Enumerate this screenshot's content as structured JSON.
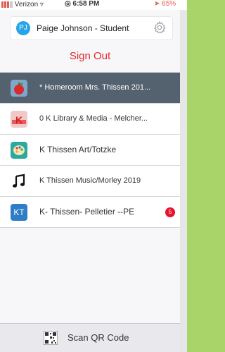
{
  "status_bar": {
    "carrier": "Verizon",
    "time": "6:58 PM",
    "battery": "65%"
  },
  "user": {
    "initials": "PJ",
    "name": "Paige Johnson - Student"
  },
  "sign_out_label": "Sign Out",
  "classes": [
    {
      "label": "* Homeroom Mrs. Thissen 201...",
      "icon": "apple-icon",
      "selected": true
    },
    {
      "label": "0 K Library & Media - Melcher...",
      "icon": "k-library-icon",
      "selected": false
    },
    {
      "label": "K Thissen Art/Totzke",
      "icon": "palette-icon",
      "selected": false
    },
    {
      "label": "K Thissen Music/Morley 2019",
      "icon": "music-note-icon",
      "selected": false
    },
    {
      "label": "K- Thissen- Pelletier --PE",
      "icon": "kt-initials-icon",
      "initials": "KT",
      "badge": "5",
      "selected": false
    }
  ],
  "scan_label": "Scan QR Code",
  "colors": {
    "selected_row": "#546270",
    "sign_out": "#e02a2a",
    "avatar": "#27a5e6",
    "badge": "#e8122d",
    "frame": "#a9d46a"
  }
}
